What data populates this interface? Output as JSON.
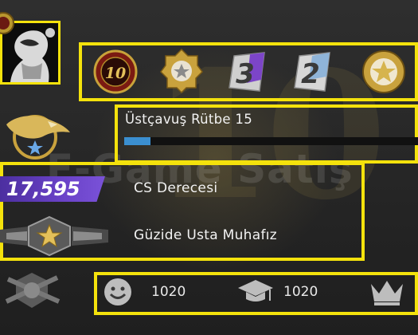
{
  "profile": {
    "rank_title": "Üstçavuş Rütbe 15",
    "xp_progress": 0.09,
    "watermark": "E-Game Satış"
  },
  "medals": [
    {
      "icon": "10-year-veteran-coin-icon",
      "text": "10"
    },
    {
      "icon": "service-medal-icon"
    },
    {
      "icon": "operation-coin-3-icon",
      "text": "3"
    },
    {
      "icon": "operation-coin-2-icon",
      "text": "2"
    },
    {
      "icon": "gold-star-medal-icon"
    }
  ],
  "competitive": {
    "skill_value": "17,595",
    "skill_label": "CS Derecesi",
    "rank_label": "Güzide Usta Muhafız"
  },
  "commendations": [
    {
      "icon": "friendly-icon",
      "value": "1020"
    },
    {
      "icon": "teacher-icon",
      "value": "1020"
    },
    {
      "icon": "leader-icon",
      "value": ""
    }
  ],
  "colors": {
    "highlight": "#f4e20c",
    "xp_bar": "#3b8fd0",
    "skill_badge": "#6a42c8"
  }
}
